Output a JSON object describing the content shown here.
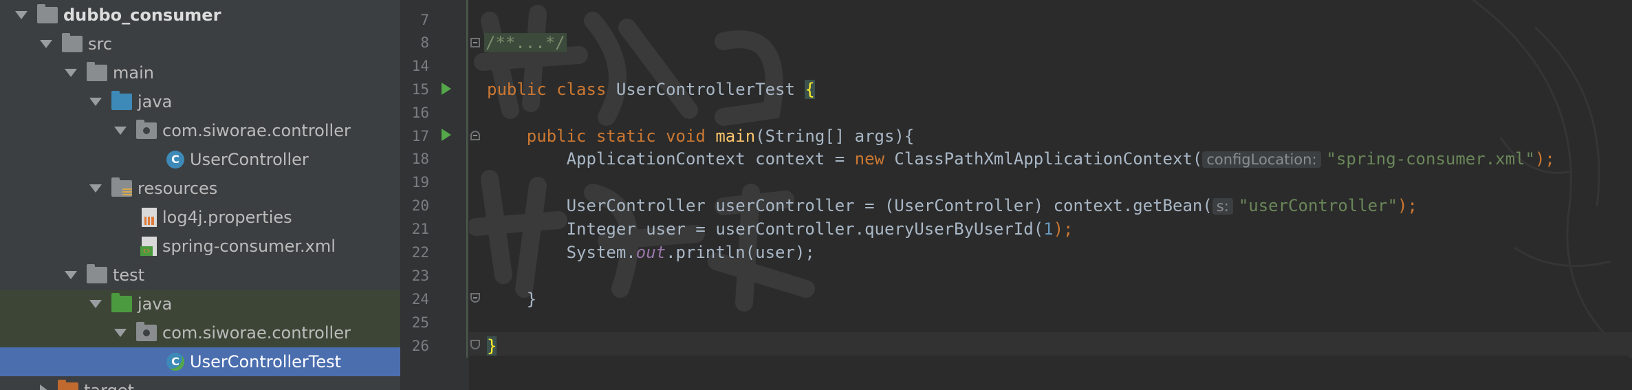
{
  "project_tree": {
    "items": [
      {
        "label": "dubbo_consumer",
        "icon": "folder-icon",
        "expanded": true
      },
      {
        "label": "src",
        "icon": "folder-icon",
        "expanded": true
      },
      {
        "label": "main",
        "icon": "folder-icon",
        "expanded": true
      },
      {
        "label": "java",
        "icon": "source-folder-icon",
        "expanded": true
      },
      {
        "label": "com.siworae.controller",
        "icon": "package-icon",
        "expanded": true
      },
      {
        "label": "UserController",
        "icon": "class-icon"
      },
      {
        "label": "resources",
        "icon": "resources-folder-icon",
        "expanded": true
      },
      {
        "label": "log4j.properties",
        "icon": "properties-file-icon"
      },
      {
        "label": "spring-consumer.xml",
        "icon": "xml-file-icon"
      },
      {
        "label": "test",
        "icon": "folder-icon",
        "expanded": true
      },
      {
        "label": "java",
        "icon": "test-folder-icon",
        "expanded": true
      },
      {
        "label": "com.siworae.controller",
        "icon": "package-icon",
        "expanded": true
      },
      {
        "label": "UserControllerTest",
        "icon": "test-class-icon",
        "selected": true
      },
      {
        "label": "target",
        "icon": "excluded-folder-icon",
        "expanded": false
      }
    ]
  },
  "editor": {
    "line_numbers": [
      "7",
      "8",
      "14",
      "15",
      "16",
      "17",
      "18",
      "19",
      "20",
      "21",
      "22",
      "23",
      "24",
      "25",
      "26"
    ],
    "lines": {
      "l8_fold": "/**...*/",
      "l15_a": "public class ",
      "l15_b": "UserControllerTest ",
      "l15_c": "{",
      "l17_a": "    public static void ",
      "l17_b": "main",
      "l17_c": "(String[] args){",
      "l18_a": "        ApplicationContext context = ",
      "l18_b": "new ",
      "l18_c": "ClassPathXmlApplicationContext(",
      "l18_hint": "configLocation:",
      "l18_d": "\"spring-consumer.xml\"",
      "l18_e": ");",
      "l20_a": "        UserController userController = (UserController) context.getBean(",
      "l20_hint": "s:",
      "l20_b": "\"userController\"",
      "l20_c": ");",
      "l21_a": "        Integer user = userController.queryUserByUserId(",
      "l21_b": "1",
      "l21_c": ");",
      "l22_a": "        System.",
      "l22_b": "out",
      "l22_c": ".println(user);",
      "l24": "    }",
      "l26": "}"
    }
  },
  "colors": {
    "keyword": "#cc7832",
    "method": "#ffc66d",
    "string": "#6a8759",
    "number": "#6897bb",
    "selection": "#4b6eaf"
  }
}
